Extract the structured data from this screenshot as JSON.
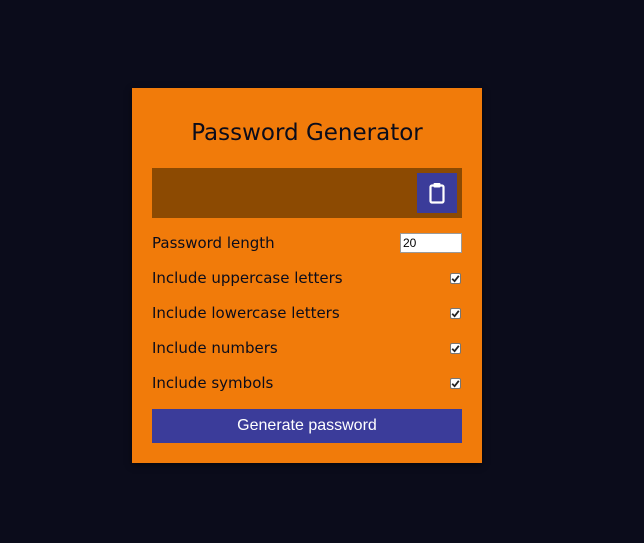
{
  "app": {
    "title": "Password Generator"
  },
  "result": {
    "value": "",
    "copy_icon": "clipboard-icon"
  },
  "settings": {
    "length": {
      "label": "Password length",
      "value": "20"
    },
    "options": [
      {
        "label": "Include uppercase letters",
        "checked": true
      },
      {
        "label": "Include lowercase letters",
        "checked": true
      },
      {
        "label": "Include numbers",
        "checked": true
      },
      {
        "label": "Include symbols",
        "checked": true
      }
    ]
  },
  "actions": {
    "generate_label": "Generate password"
  },
  "colors": {
    "background": "#0b0c1b",
    "card": "#f17b0a",
    "result_box": "#8c4a02",
    "accent": "#3b3c9a"
  }
}
